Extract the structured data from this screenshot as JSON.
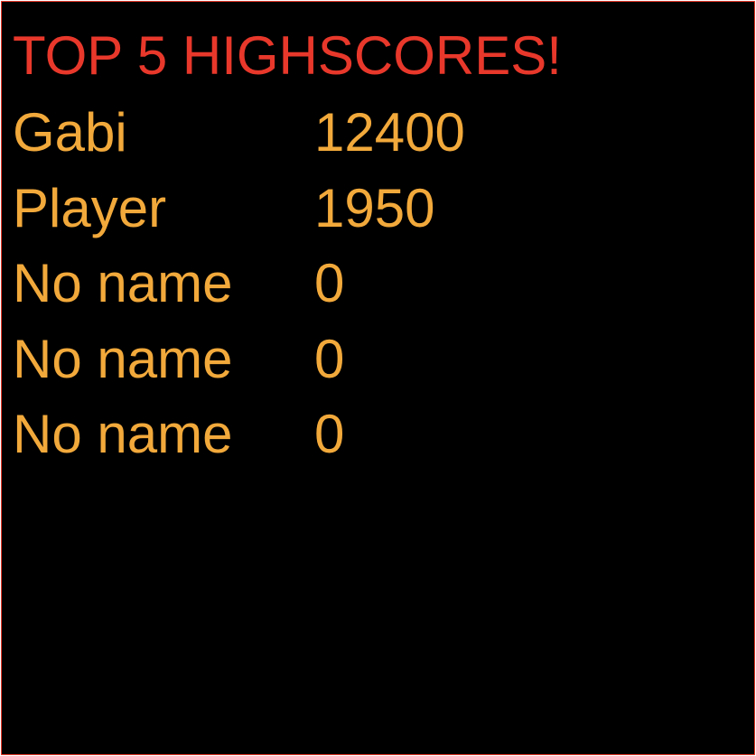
{
  "title": "TOP 5 HIGHSCORES!",
  "colors": {
    "title": "#e8382b",
    "entries": "#f2a93b",
    "background": "#000000",
    "border": "#e53a2a"
  },
  "highscores": [
    {
      "name": "Gabi",
      "score": "12400"
    },
    {
      "name": "Player",
      "score": "1950"
    },
    {
      "name": "No name",
      "score": "0"
    },
    {
      "name": "No name",
      "score": "0"
    },
    {
      "name": "No name",
      "score": "0"
    }
  ]
}
